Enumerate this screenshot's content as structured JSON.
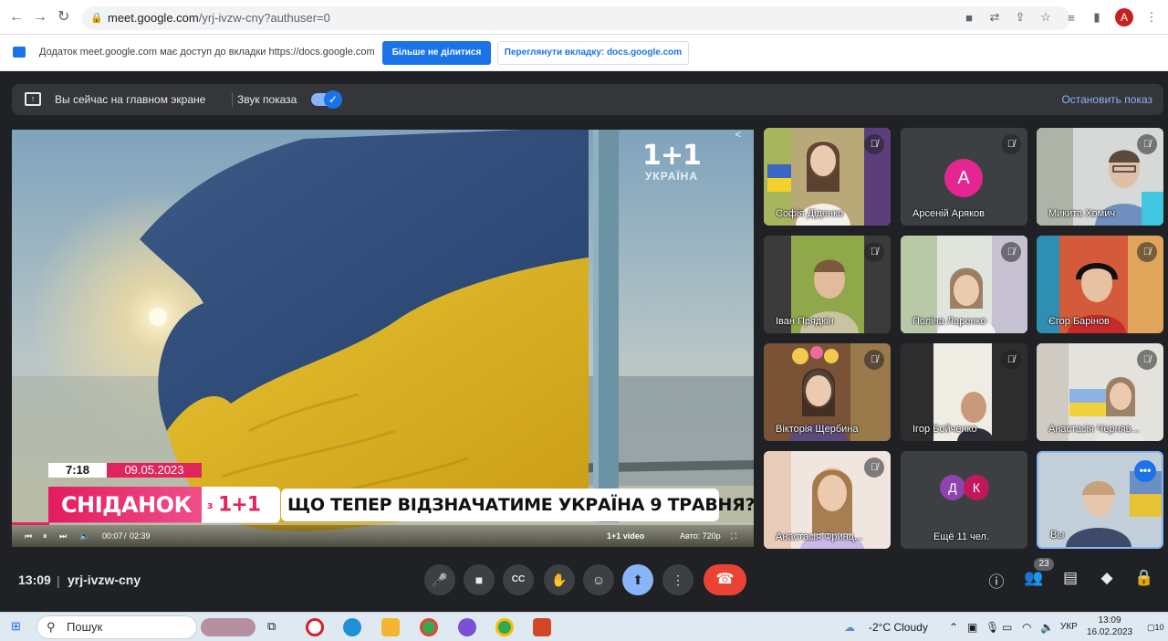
{
  "browser": {
    "url_host": "meet.google.com",
    "url_path": "/yrj-ivzw-cny?authuser=0",
    "avatar_letter": "A"
  },
  "infobar": {
    "message": "Додаток meet.google.com має доступ до вкладки https://docs.google.com",
    "stop_sharing_label": "Більше не ділитися",
    "view_tab_label": "Переглянути вкладку: docs.google.com"
  },
  "presenting_bar": {
    "status": "Вы сейчас на главном экране",
    "sound_label": "Звук показа",
    "stop_label": "Остановить показ"
  },
  "stage": {
    "channel_logo": "1+1",
    "channel_sub": "УКРАЇНА",
    "time": "7:18",
    "date": "09.05.2023",
    "program": "СНІДАНОК",
    "with": "з",
    "with_logo": "1+1",
    "headline": "ЩО ТЕПЕР ВІДЗНАЧАТИМЕ УКРАЇНА 9 ТРАВНЯ?",
    "player": {
      "elapsed": "00:07",
      "duration": "02:39",
      "brand": "1+1 video",
      "quality": "Авто: 720р",
      "progress": 0.05
    }
  },
  "participants": [
    {
      "name": "Софія Діденко"
    },
    {
      "name": "Арсеній Аряков",
      "avatar_letter": "A"
    },
    {
      "name": "Микита Хомич"
    },
    {
      "name": "Іван Прядкін"
    },
    {
      "name": "Поліна Ларенко"
    },
    {
      "name": "Єгор Барінов"
    },
    {
      "name": "Вікторія Щербина"
    },
    {
      "name": "Ігор Бойченко"
    },
    {
      "name": "Анастасія Черняв..."
    },
    {
      "name": "Анастасія Фринц..."
    },
    {
      "name": "Ещё 11 чел.",
      "avatar_letters": [
        "Д",
        "К"
      ]
    },
    {
      "name": "Вы"
    }
  ],
  "bottom_bar": {
    "time": "13:09",
    "separator": "|",
    "meeting_code": "yrj-ivzw-cny",
    "participant_count": "23"
  },
  "taskbar": {
    "search_label": "Пошук",
    "weather": "-2°C  Cloudy",
    "language": "УКР",
    "clock_time": "13:09",
    "clock_date": "16.02.2023",
    "notification_count": "10"
  },
  "colors": {
    "meet_bg": "#202124",
    "accent_blue": "#1a73e8",
    "end_call_red": "#ea4335",
    "brand_pink": "#e0245e"
  },
  "icons": {
    "mic": "mic-icon",
    "camera": "camera-icon",
    "captions": "captions-icon",
    "hand": "raise-hand-icon",
    "emoji": "emoji-icon",
    "present": "present-icon",
    "more": "more-vert-icon",
    "end": "end-call-icon"
  }
}
